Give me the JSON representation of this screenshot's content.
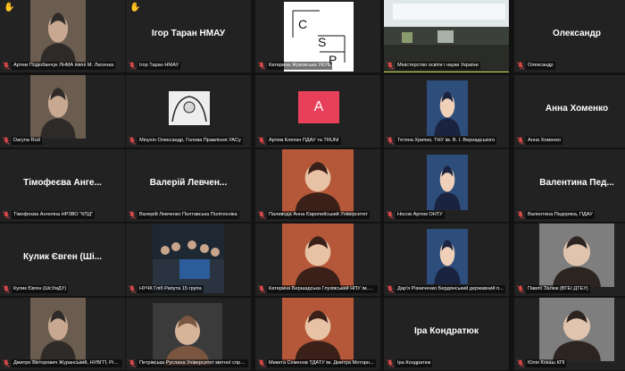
{
  "colors": {
    "background": "#121212",
    "tile": "#222222",
    "active_border": "#d6e05a",
    "muted_mic": "#e04a4a",
    "hand": "#f5c542",
    "avatar_a": "#e8405a"
  },
  "tiles": [
    {
      "name": "Артем Подюбанчук ЛНМА імені М. Лисенка",
      "big": "",
      "hand": true,
      "video": true,
      "kind": "person"
    },
    {
      "name": "Ігор Таран НМАУ",
      "big": "Ігор Таран НМАУ",
      "hand": true,
      "video": false,
      "kind": "text"
    },
    {
      "name": "Катерина Жуковська УКУБ",
      "big": "",
      "hand": false,
      "video": true,
      "kind": "csp",
      "logo": [
        "C",
        "S",
        "P"
      ]
    },
    {
      "name": "Міністерство освіти і науки України",
      "big": "",
      "hand": false,
      "video": true,
      "kind": "hall",
      "active": true
    },
    {
      "name": "Олександр",
      "big": "Олександр",
      "hand": false,
      "video": false,
      "kind": "text"
    },
    {
      "name": "Daryna Rud",
      "big": "",
      "hand": false,
      "video": true,
      "kind": "person"
    },
    {
      "name": "Мінухін Олександр, Голова Правління УАСу",
      "big": "",
      "hand": false,
      "video": true,
      "kind": "drawing"
    },
    {
      "name": "Артем Клепач ПДАУ та TRUNI",
      "big": "",
      "hand": false,
      "video": true,
      "kind": "avatar",
      "avatar_letter": "A"
    },
    {
      "name": "Тетяна Хрипко, ТНУ ім. В. І. Вернадського",
      "big": "",
      "hand": false,
      "video": true,
      "kind": "person"
    },
    {
      "name": "Анна Хоменко",
      "big": "Анна Хоменко",
      "hand": false,
      "video": false,
      "kind": "text"
    },
    {
      "name": "Тімофеєва Ангеліна НРЗВО \"КПД\"",
      "big": "Тімофеєва Анге...",
      "hand": false,
      "video": false,
      "kind": "text"
    },
    {
      "name": "Валерій Левченко Полтавська Політехніка",
      "big": "Валерій Левчен...",
      "hand": false,
      "video": false,
      "kind": "text"
    },
    {
      "name": "Паливода Анна Європейський Університет",
      "big": "",
      "hand": false,
      "video": true,
      "kind": "person"
    },
    {
      "name": "Носов Артем ОНТУ",
      "big": "",
      "hand": false,
      "video": true,
      "kind": "person"
    },
    {
      "name": "Валентина Педоряка, ПДАУ",
      "big": "Валентина Пед...",
      "hand": false,
      "video": false,
      "kind": "text"
    },
    {
      "name": "Кулик Євген (ШсУмДУ)",
      "big": "Кулик Євген (Ші...",
      "hand": false,
      "video": false,
      "kind": "text"
    },
    {
      "name": "НУЧК Гліб Рапута 15 група",
      "big": "",
      "hand": false,
      "video": true,
      "kind": "group"
    },
    {
      "name": "Катерина Бершадська Глухівський НПУ ім.О...",
      "big": "",
      "hand": false,
      "video": true,
      "kind": "person"
    },
    {
      "name": "Дар'я Різниченко Бердянський державний п...",
      "big": "",
      "hand": false,
      "video": true,
      "kind": "person"
    },
    {
      "name": "Павло Залюк (ВТЕІ ДТЕУ)",
      "big": "",
      "hand": false,
      "video": true,
      "kind": "person"
    },
    {
      "name": "Дмитро Вікторович Журанський, НУВГП, Рівне",
      "big": "",
      "hand": false,
      "video": true,
      "kind": "person"
    },
    {
      "name": "Петрівська Руслана Університет митної спра...",
      "big": "",
      "hand": false,
      "video": true,
      "kind": "person"
    },
    {
      "name": "Микита Семенов ТДАТУ ім. Дмитра Моторн...",
      "big": "",
      "hand": false,
      "video": true,
      "kind": "person"
    },
    {
      "name": "Іра Кондратюк",
      "big": "Іра Кондратюк",
      "hand": false,
      "video": false,
      "kind": "text"
    },
    {
      "name": "Юлія Кокаш КПІ",
      "big": "",
      "hand": false,
      "video": true,
      "kind": "person"
    }
  ]
}
